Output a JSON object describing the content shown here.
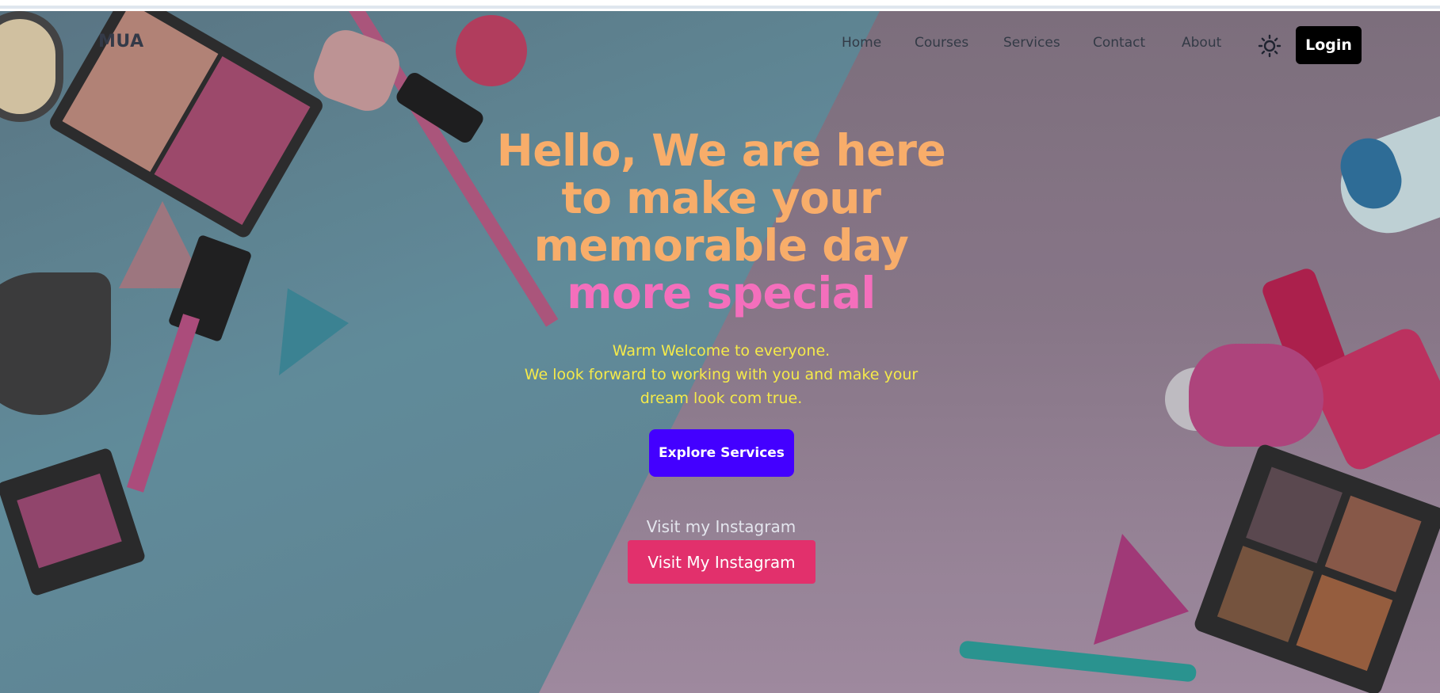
{
  "brand": {
    "name": "MUA"
  },
  "nav": {
    "items": [
      {
        "label": "Home"
      },
      {
        "label": "Courses"
      },
      {
        "label": "Services"
      },
      {
        "label": "Contact"
      },
      {
        "label": "About"
      }
    ],
    "theme_icon": "sun-icon",
    "login_label": "Login"
  },
  "hero": {
    "headline_lines": [
      "Hello, We are here",
      "to make your",
      "memorable day"
    ],
    "headline_accent": "more special",
    "sub_lines": [
      "Warm Welcome to everyone.",
      "We look forward to working with you and make your",
      "dream look com true."
    ],
    "cta_label": "Explore Services",
    "instagram_caption": "Visit my Instagram",
    "instagram_button": "Visit My Instagram"
  },
  "colors": {
    "headline": "#f8ad6a",
    "accent": "#f46fbc",
    "subtext": "#f5ea4a",
    "cta": "#4300ff",
    "instagram": "#e2306c",
    "login_bg": "#000000"
  }
}
